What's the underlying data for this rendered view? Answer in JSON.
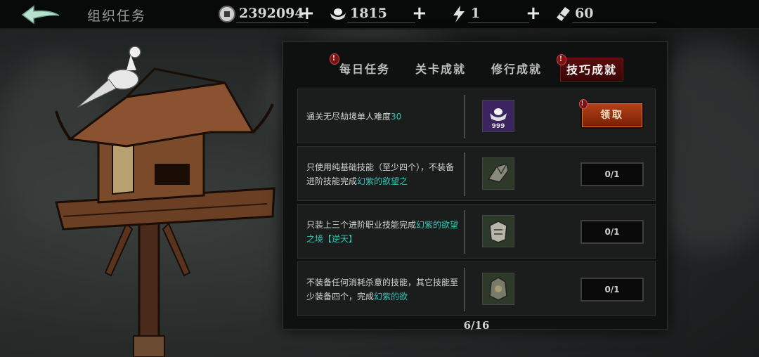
{
  "header": {
    "title": "组织任务",
    "resources": [
      {
        "icon": "coin-icon",
        "value": "2392094"
      },
      {
        "icon": "silver-ingot-icon",
        "value": "1815"
      },
      {
        "icon": "lightning-icon",
        "value": "1"
      },
      {
        "icon": "ticket-icon",
        "value": "60"
      }
    ]
  },
  "tabs": [
    {
      "label": "每日任务",
      "badge": "!",
      "active": false
    },
    {
      "label": "关卡成就",
      "active": false
    },
    {
      "label": "修行成就",
      "active": false
    },
    {
      "label": "技巧成就",
      "badge": "!",
      "active": true
    }
  ],
  "tasks": [
    {
      "desc_plain": "通关无尽劫境单人难度",
      "desc_hl": "30",
      "desc_tail": "",
      "reward_icon": "purple-ingot-icon",
      "reward_qty": "999",
      "action": "claim",
      "action_label": "领取",
      "badge": "!"
    },
    {
      "desc_plain": "只使用纯基础技能（至少四个），不装备进阶技能完成",
      "desc_hl": "幻紫的欲望之",
      "desc_tail": "",
      "reward_icon": "gauntlet-icon",
      "action": "progress",
      "progress": "0/1"
    },
    {
      "desc_plain": "只装上三个进阶职业技能完成",
      "desc_hl": "幻紫的欲望之境【逆天】",
      "desc_tail": "",
      "reward_icon": "armor-icon",
      "action": "progress",
      "progress": "0/1"
    },
    {
      "desc_plain": "不装备任何消耗杀意的技能，其它技能至少装备四个，完成",
      "desc_hl": "幻紫的欲",
      "desc_tail": "",
      "reward_icon": "chest-armor-icon",
      "action": "progress",
      "progress": "0/1"
    }
  ],
  "pager": "6/16",
  "colors": {
    "highlight": "#34c6b6",
    "active_tab": "#5a0c0c",
    "claim_button": "#b24216"
  }
}
